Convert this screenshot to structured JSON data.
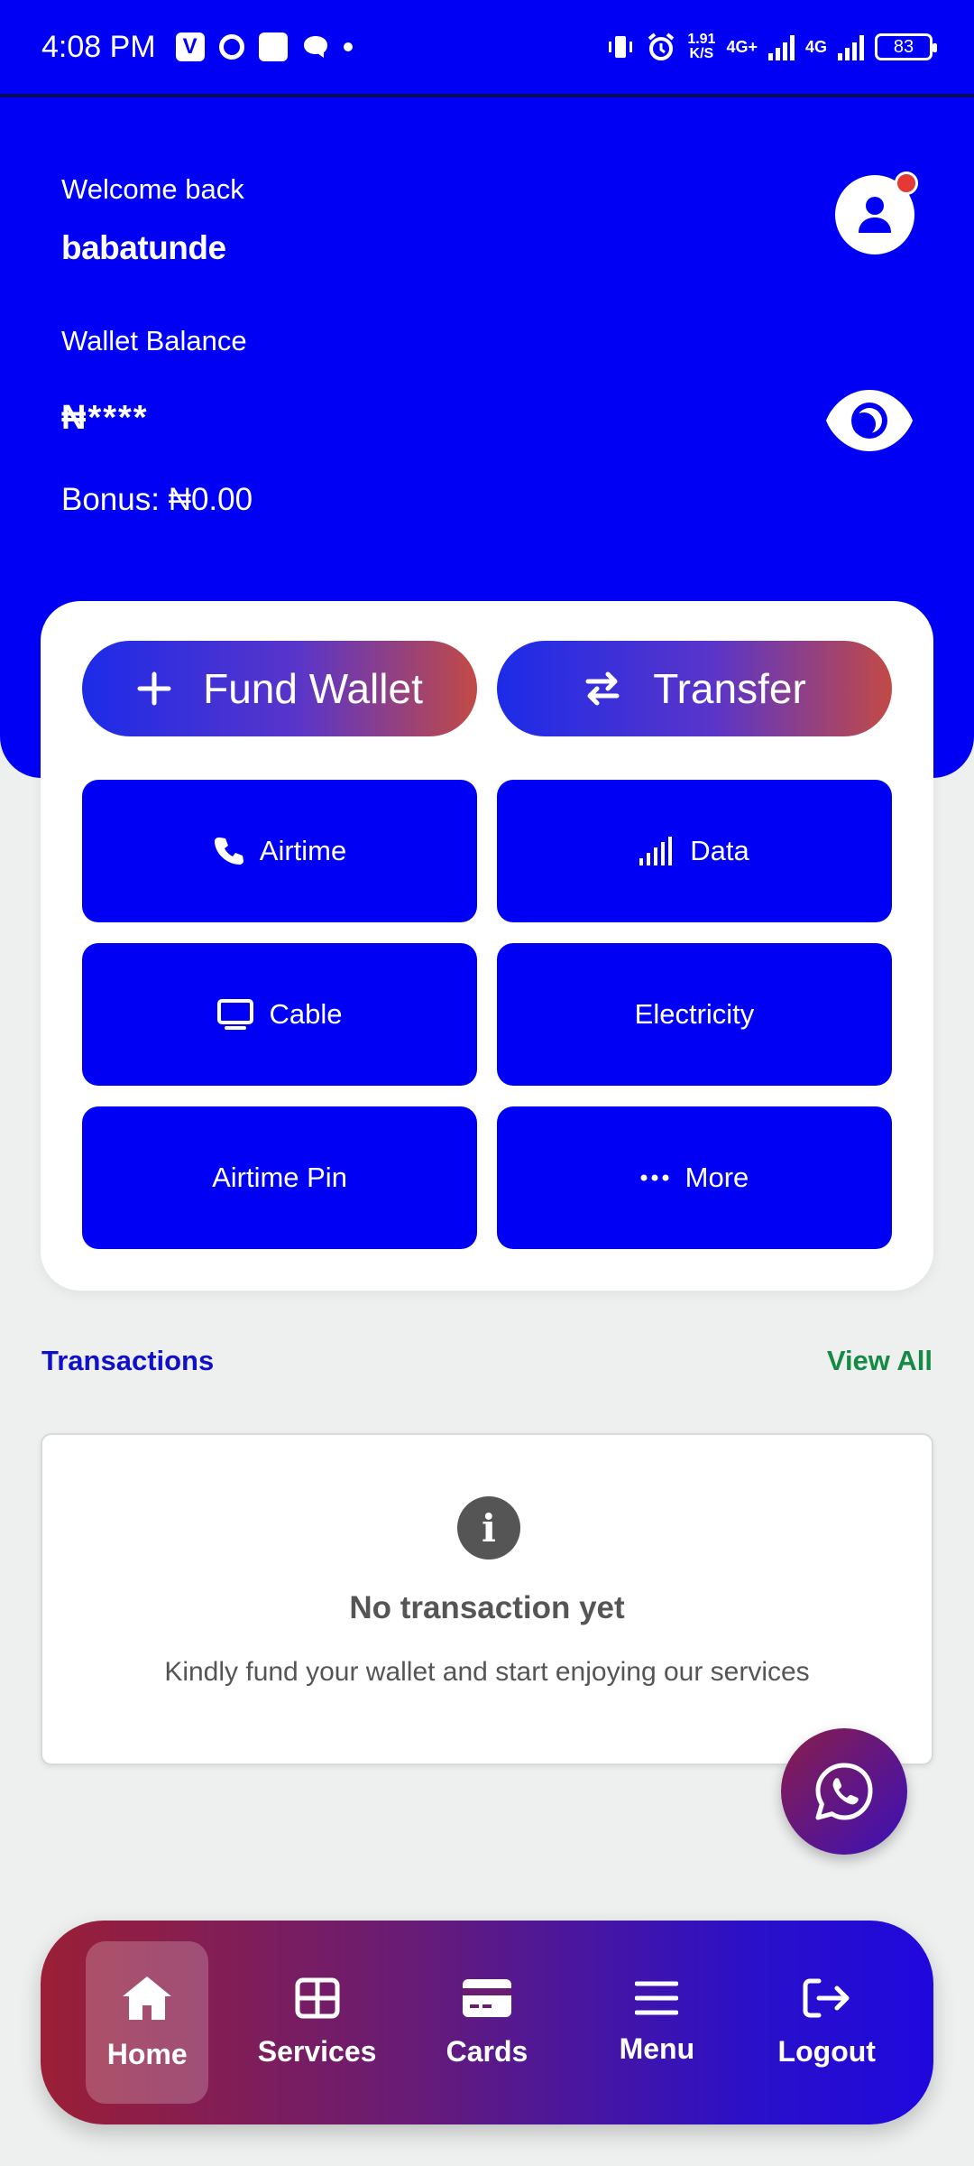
{
  "status_bar": {
    "time": "4:08 PM",
    "speed_value": "1.91",
    "speed_unit": "K/S",
    "network_1": "4G+",
    "network_2": "4G",
    "battery": "83"
  },
  "header": {
    "welcome": "Welcome back",
    "username": "babatunde",
    "wallet_label": "Wallet Balance",
    "balance_masked": "₦****",
    "bonus": "Bonus: ₦0.00"
  },
  "actions": {
    "fund_wallet": "Fund Wallet",
    "transfer": "Transfer",
    "tiles": [
      "Airtime",
      "Data",
      "Cable",
      "Electricity",
      "Airtime Pin",
      "More"
    ]
  },
  "transactions": {
    "title": "Transactions",
    "view_all": "View All",
    "empty_title": "No transaction yet",
    "empty_subtitle": "Kindly fund your wallet and start enjoying our services"
  },
  "nav": {
    "items": [
      "Home",
      "Services",
      "Cards",
      "Menu",
      "Logout"
    ],
    "active": "Home"
  },
  "colors": {
    "primary": "#0000f5",
    "accent_red": "#c24a45",
    "view_all": "#148a44",
    "notification": "#e53935"
  },
  "icons": {
    "avatar": "user-icon",
    "balance_toggle": "eye-icon",
    "fund_wallet": "plus-icon",
    "transfer": "transfer-arrows-icon",
    "airtime": "phone-icon",
    "data": "signal-icon",
    "cable": "monitor-icon",
    "more": "dots-icon",
    "empty_state": "info-icon",
    "fab": "whatsapp-icon",
    "nav": [
      "home-icon",
      "grid-icon",
      "credit-card-icon",
      "menu-icon",
      "logout-icon"
    ]
  }
}
